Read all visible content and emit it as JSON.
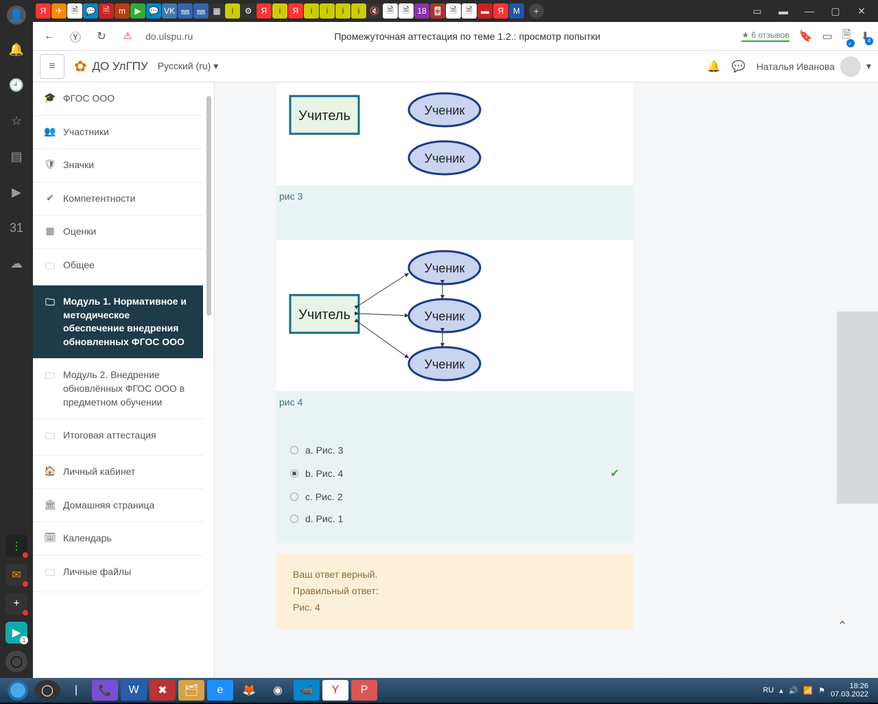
{
  "browser": {
    "url": "do.ulspu.ru",
    "page_title": "Промежуточная аттестация по теме 1.2.: просмотр попытки",
    "reviews": "★ 6 отзывов",
    "download_badge": "4"
  },
  "moodle": {
    "site_name": "ДО УлГПУ",
    "language": "Русский (ru)",
    "user_name": "Наталья Иванова"
  },
  "nav": {
    "items": [
      {
        "icon": "🎓",
        "label": "ФГОС ООО"
      },
      {
        "icon": "👥",
        "label": "Участники"
      },
      {
        "icon": "🛡",
        "label": "Значки"
      },
      {
        "icon": "✔",
        "label": "Компетентности"
      },
      {
        "icon": "▦",
        "label": "Оценки"
      },
      {
        "icon": "🗀",
        "label": "Общее"
      },
      {
        "icon": "🗀",
        "label": "Модуль 1. Нормативное и методическое обеспечение внедрения обновленных ФГОС ООО",
        "active": true
      },
      {
        "icon": "🗀",
        "label": "Модуль 2. Внедрение обновлённых ФГОС ООО в предметном обучении"
      },
      {
        "icon": "🗀",
        "label": "Итоговая аттестация"
      },
      {
        "icon": "🏠",
        "label": "Личный кабинет"
      },
      {
        "icon": "🏛",
        "label": "Домашняя страница"
      },
      {
        "icon": "🗓",
        "label": "Календарь"
      },
      {
        "icon": "🗀",
        "label": "Личные файлы"
      }
    ]
  },
  "diagrams": {
    "teacher": "Учитель",
    "student": "Ученик",
    "caption3": "рис 3",
    "caption4": "рис 4"
  },
  "answers": {
    "a": "a. Рис. 3",
    "b": "b. Рис. 4",
    "c": "c. Рис. 2",
    "d": "d. Рис. 1"
  },
  "feedback": {
    "correct_msg": "Ваш ответ верный.",
    "answer_label": "Правильный ответ:",
    "answer_value": "Рис. 4"
  },
  "taskbar": {
    "lang": "RU",
    "time": "18:26",
    "date": "07.03.2022"
  }
}
